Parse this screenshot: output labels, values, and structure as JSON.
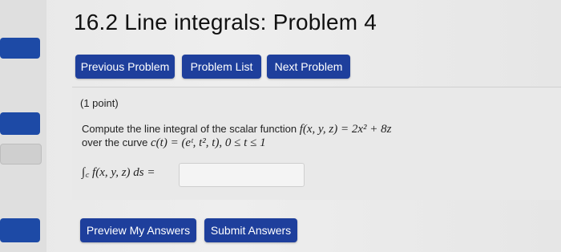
{
  "page": {
    "title": "16.2 Line integrals: Problem 4"
  },
  "nav": {
    "previous_label": "Previous Problem",
    "list_label": "Problem List",
    "next_label": "Next Problem"
  },
  "problem": {
    "points": "(1 point)",
    "statement_prefix": "Compute the line integral of the scalar function",
    "function_expr": "f(x, y, z) = 2x² + 8z",
    "curve_prefix": "over the curve",
    "curve_expr": "c(t) = (eᵗ, t², t),   0 ≤ t ≤ 1",
    "integral_expr": "∫꜀ f(x, y, z) ds =",
    "answer_value": ""
  },
  "actions": {
    "preview_label": "Preview My Answers",
    "submit_label": "Submit Answers"
  },
  "colors": {
    "button_blue": "#1e3f9c",
    "background": "#e8e8e8"
  }
}
